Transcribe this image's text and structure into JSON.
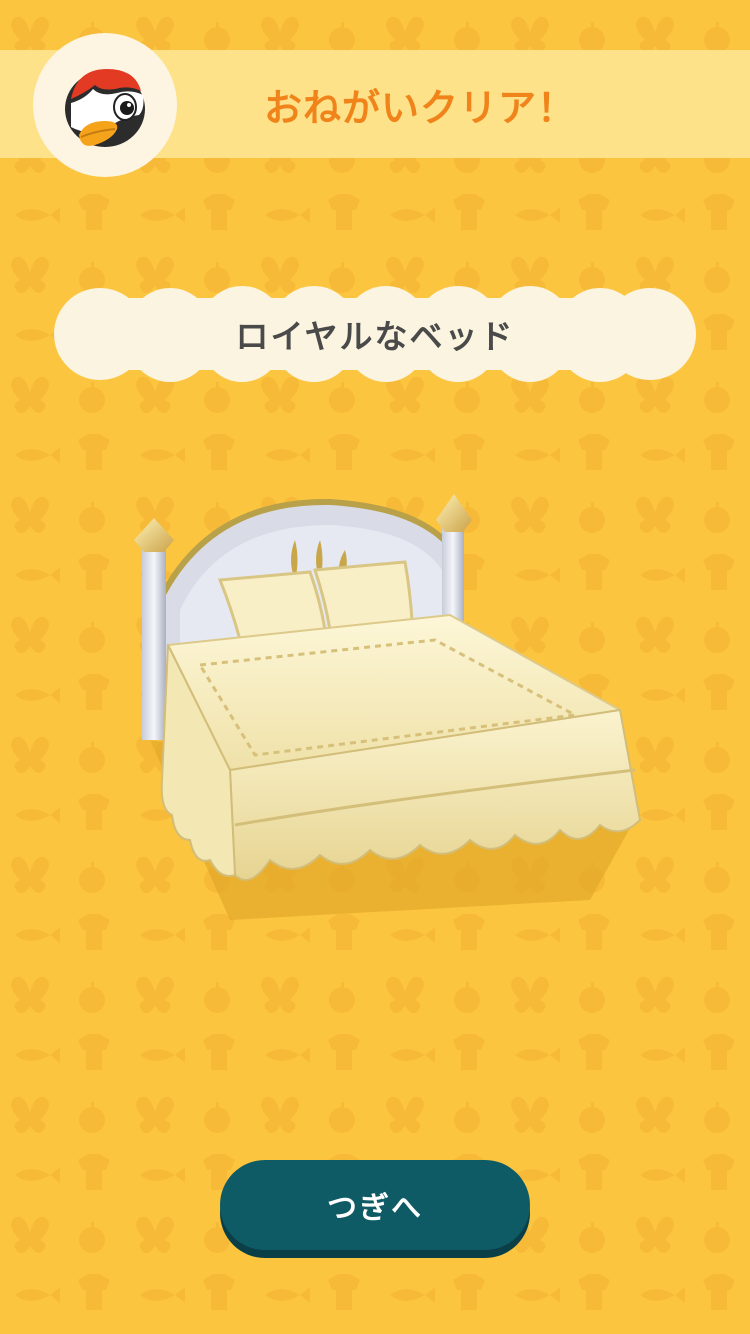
{
  "header": {
    "title": "おねがいクリア！",
    "avatar_icon": "penguin-villager-icon"
  },
  "reward": {
    "item_name": "ロイヤルなベッド",
    "item_icon": "royal-bed"
  },
  "actions": {
    "next_label": "つぎへ"
  },
  "colors": {
    "background": "#fcc540",
    "banner": "#fde28a",
    "title_text": "#f0841a",
    "name_cloud": "#fbf4e0",
    "button": "#0f5b65"
  }
}
